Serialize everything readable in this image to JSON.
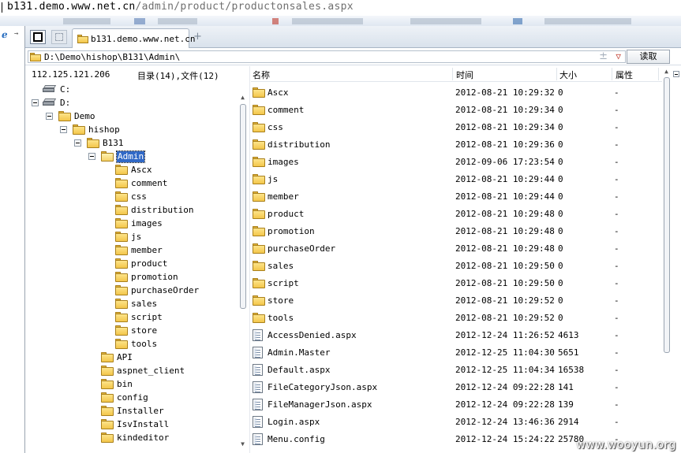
{
  "address_bar": {
    "host": "b131.demo.www.net.cn",
    "path": "/admin/product/productonsales.aspx"
  },
  "tab": {
    "label": "b131.demo.www.net.cn",
    "new_tab_symbol": "+"
  },
  "path_bar": {
    "path": "D:\\Demo\\hishop\\B131\\Admin\\",
    "read_button": "读取"
  },
  "left_pane": {
    "ip": "112.125.121.206",
    "counts": "目录(14),文件(12)",
    "tree": [
      {
        "label": "C:",
        "type": "drive",
        "depth": 0,
        "expander": false
      },
      {
        "label": "D:",
        "type": "drive",
        "depth": 0,
        "expander": true
      },
      {
        "label": "Demo",
        "type": "folder",
        "depth": 1,
        "expander": true
      },
      {
        "label": "hishop",
        "type": "folder",
        "depth": 2,
        "expander": true
      },
      {
        "label": "B131",
        "type": "folder",
        "depth": 3,
        "expander": true
      },
      {
        "label": "Admin",
        "type": "folder",
        "depth": 4,
        "expander": true,
        "selected": true
      },
      {
        "label": "Ascx",
        "type": "folder",
        "depth": 5,
        "expander": false
      },
      {
        "label": "comment",
        "type": "folder",
        "depth": 5,
        "expander": false
      },
      {
        "label": "css",
        "type": "folder",
        "depth": 5,
        "expander": false
      },
      {
        "label": "distribution",
        "type": "folder",
        "depth": 5,
        "expander": false
      },
      {
        "label": "images",
        "type": "folder",
        "depth": 5,
        "expander": false
      },
      {
        "label": "js",
        "type": "folder",
        "depth": 5,
        "expander": false
      },
      {
        "label": "member",
        "type": "folder",
        "depth": 5,
        "expander": false
      },
      {
        "label": "product",
        "type": "folder",
        "depth": 5,
        "expander": false
      },
      {
        "label": "promotion",
        "type": "folder",
        "depth": 5,
        "expander": false
      },
      {
        "label": "purchaseOrder",
        "type": "folder",
        "depth": 5,
        "expander": false
      },
      {
        "label": "sales",
        "type": "folder",
        "depth": 5,
        "expander": false
      },
      {
        "label": "script",
        "type": "folder",
        "depth": 5,
        "expander": false
      },
      {
        "label": "store",
        "type": "folder",
        "depth": 5,
        "expander": false
      },
      {
        "label": "tools",
        "type": "folder",
        "depth": 5,
        "expander": false
      },
      {
        "label": "API",
        "type": "folder",
        "depth": 4,
        "expander": false
      },
      {
        "label": "aspnet_client",
        "type": "folder",
        "depth": 4,
        "expander": false
      },
      {
        "label": "bin",
        "type": "folder",
        "depth": 4,
        "expander": false
      },
      {
        "label": "config",
        "type": "folder",
        "depth": 4,
        "expander": false
      },
      {
        "label": "Installer",
        "type": "folder",
        "depth": 4,
        "expander": false
      },
      {
        "label": "IsvInstall",
        "type": "folder",
        "depth": 4,
        "expander": false
      },
      {
        "label": "kindeditor",
        "type": "folder",
        "depth": 4,
        "expander": false
      }
    ]
  },
  "file_list": {
    "columns": {
      "name": "名称",
      "time": "时间",
      "size": "大小",
      "attr": "属性"
    },
    "rows": [
      {
        "type": "folder",
        "name": "Ascx",
        "time": "2012-08-21 10:29:32",
        "size": "0",
        "attr": "-"
      },
      {
        "type": "folder",
        "name": "comment",
        "time": "2012-08-21 10:29:34",
        "size": "0",
        "attr": "-"
      },
      {
        "type": "folder",
        "name": "css",
        "time": "2012-08-21 10:29:34",
        "size": "0",
        "attr": "-"
      },
      {
        "type": "folder",
        "name": "distribution",
        "time": "2012-08-21 10:29:36",
        "size": "0",
        "attr": "-"
      },
      {
        "type": "folder",
        "name": "images",
        "time": "2012-09-06 17:23:54",
        "size": "0",
        "attr": "-"
      },
      {
        "type": "folder",
        "name": "js",
        "time": "2012-08-21 10:29:44",
        "size": "0",
        "attr": "-"
      },
      {
        "type": "folder",
        "name": "member",
        "time": "2012-08-21 10:29:44",
        "size": "0",
        "attr": "-"
      },
      {
        "type": "folder",
        "name": "product",
        "time": "2012-08-21 10:29:48",
        "size": "0",
        "attr": "-"
      },
      {
        "type": "folder",
        "name": "promotion",
        "time": "2012-08-21 10:29:48",
        "size": "0",
        "attr": "-"
      },
      {
        "type": "folder",
        "name": "purchaseOrder",
        "time": "2012-08-21 10:29:48",
        "size": "0",
        "attr": "-"
      },
      {
        "type": "folder",
        "name": "sales",
        "time": "2012-08-21 10:29:50",
        "size": "0",
        "attr": "-"
      },
      {
        "type": "folder",
        "name": "script",
        "time": "2012-08-21 10:29:50",
        "size": "0",
        "attr": "-"
      },
      {
        "type": "folder",
        "name": "store",
        "time": "2012-08-21 10:29:52",
        "size": "0",
        "attr": "-"
      },
      {
        "type": "folder",
        "name": "tools",
        "time": "2012-08-21 10:29:52",
        "size": "0",
        "attr": "-"
      },
      {
        "type": "file",
        "name": "AccessDenied.aspx",
        "time": "2012-12-24 11:26:52",
        "size": "4613",
        "attr": "-"
      },
      {
        "type": "file",
        "name": "Admin.Master",
        "time": "2012-12-25 11:04:30",
        "size": "5651",
        "attr": "-"
      },
      {
        "type": "file",
        "name": "Default.aspx",
        "time": "2012-12-25 11:04:34",
        "size": "16538",
        "attr": "-"
      },
      {
        "type": "file",
        "name": "FileCategoryJson.aspx",
        "time": "2012-12-24 09:22:28",
        "size": "141",
        "attr": "-"
      },
      {
        "type": "file",
        "name": "FileManagerJson.aspx",
        "time": "2012-12-24 09:22:28",
        "size": "139",
        "attr": "-"
      },
      {
        "type": "file",
        "name": "Login.aspx",
        "time": "2012-12-24 13:46:36",
        "size": "2914",
        "attr": "-"
      },
      {
        "type": "file",
        "name": "Menu.config",
        "time": "2012-12-24 15:24:22",
        "size": "25780",
        "attr": "-"
      }
    ]
  },
  "watermark": "www.wooyun.org"
}
